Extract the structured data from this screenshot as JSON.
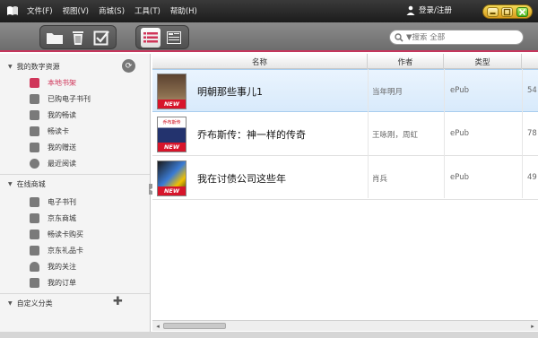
{
  "menu": [
    "文件(F)",
    "视图(V)",
    "商城(S)",
    "工具(T)",
    "帮助(H)"
  ],
  "login_label": "登录/注册",
  "search": {
    "label": "▼搜索 全部",
    "value": ""
  },
  "sidebar": {
    "section_digital": "我的数字资源",
    "digital_items": [
      {
        "label": "本地书架",
        "selected": true
      },
      {
        "label": "已购电子书刊"
      },
      {
        "label": "我的畅读"
      },
      {
        "label": "畅读卡"
      },
      {
        "label": "我的赠送"
      },
      {
        "label": "最近阅读"
      }
    ],
    "section_store": "在线商城",
    "store_items": [
      {
        "label": "电子书刊"
      },
      {
        "label": "京东商城"
      },
      {
        "label": "畅读卡购买"
      },
      {
        "label": "京东礼品卡"
      },
      {
        "label": "我的关注"
      },
      {
        "label": "我的订单"
      }
    ],
    "section_custom": "自定义分类"
  },
  "table": {
    "columns": [
      "名称",
      "作者",
      "类型"
    ],
    "rows": [
      {
        "title": "明朝那些事儿1",
        "author": "当年明月",
        "type": "ePub",
        "size": "54",
        "badge": "NEW"
      },
      {
        "title": "乔布斯传：神一样的传奇",
        "author": "王咏刚，周虹",
        "type": "ePub",
        "size": "78",
        "badge": "NEW",
        "cover_text": "乔布斯传"
      },
      {
        "title": "我在讨债公司这些年",
        "author": "肖兵",
        "type": "ePub",
        "size": "49",
        "badge": "NEW"
      }
    ]
  },
  "colors": {
    "accent": "#d0365a",
    "selected_row": "#dceafb",
    "window_button": "#e9c548"
  }
}
